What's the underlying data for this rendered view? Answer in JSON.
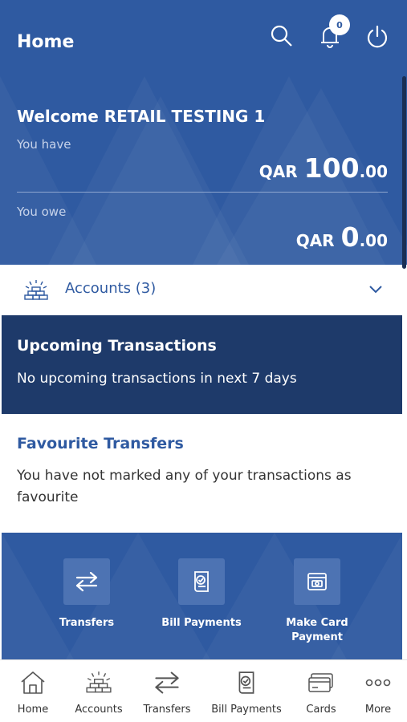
{
  "header": {
    "title": "Home",
    "notification_count": "0"
  },
  "summary": {
    "welcome": "Welcome RETAIL TESTING 1",
    "have_label": "You have",
    "have_currency": "QAR",
    "have_int": "100",
    "have_dec": ".00",
    "owe_label": "You owe",
    "owe_currency": "QAR",
    "owe_int": "0",
    "owe_dec": ".00"
  },
  "accounts": {
    "label": "Accounts (3)"
  },
  "upcoming": {
    "title": "Upcoming Transactions",
    "message": "No upcoming transactions in next 7 days"
  },
  "favourites": {
    "title": "Favourite Transfers",
    "message": "You have not marked any of your transactions as favourite"
  },
  "quick_actions": [
    {
      "label": "Transfers",
      "icon": "transfer-arrows-icon"
    },
    {
      "label": "Bill Payments",
      "icon": "bill-icon"
    },
    {
      "label": "Make Card Payment",
      "icon": "card-payment-icon"
    }
  ],
  "tabs": [
    {
      "label": "Home",
      "icon": "home-icon"
    },
    {
      "label": "Accounts",
      "icon": "accounts-icon"
    },
    {
      "label": "Transfers",
      "icon": "transfer-arrows-icon"
    },
    {
      "label": "Bill Payments",
      "icon": "bill-icon"
    },
    {
      "label": "Cards",
      "icon": "cards-icon"
    },
    {
      "label": "More",
      "icon": "more-dots-icon"
    }
  ],
  "colors": {
    "primary": "#2f5aa1",
    "dark": "#1e3a6a",
    "accent_box": "#4d73b3"
  }
}
